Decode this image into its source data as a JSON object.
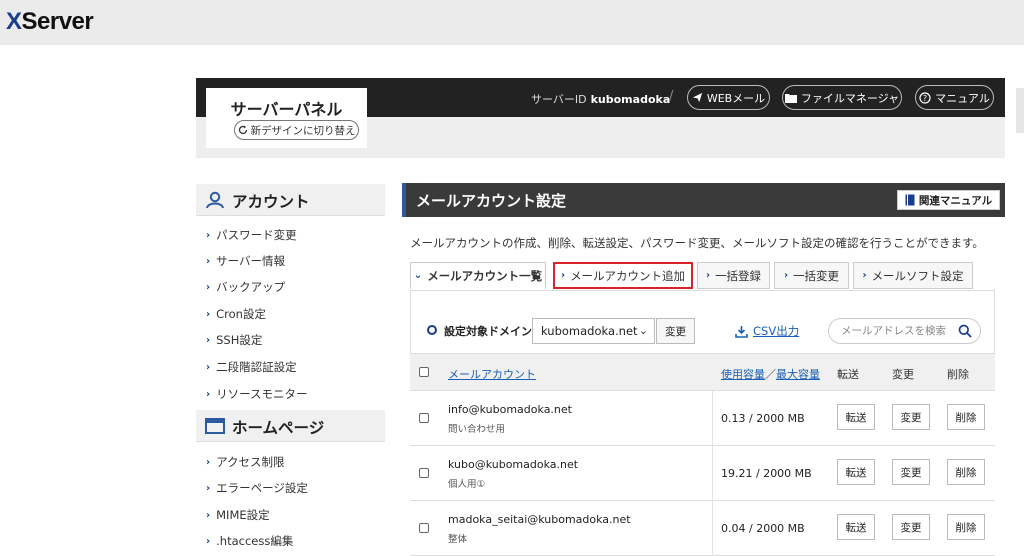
{
  "brand": {
    "logo_x": "X",
    "logo_rest": "Server"
  },
  "header": {
    "panel_title": "サーバーパネル",
    "new_design_label": "新デザインに切り替え",
    "server_id_label": "サーバーID",
    "server_id": "kubomadoka",
    "separator": "/",
    "webmail_label": "WEBメール",
    "file_manager_label": "ファイルマネージャ",
    "manual_label": "マニュアル"
  },
  "sidebar": {
    "sections": [
      {
        "title": "アカウント",
        "icon": "user-icon",
        "items": [
          "パスワード変更",
          "サーバー情報",
          "バックアップ",
          "Cron設定",
          "SSH設定",
          "二段階認証設定",
          "リソースモニター"
        ]
      },
      {
        "title": "ホームページ",
        "icon": "window-icon",
        "items": [
          "アクセス制限",
          "エラーページ設定",
          "MIME設定",
          ".htaccess編集"
        ]
      }
    ]
  },
  "main": {
    "title": "メールアカウント設定",
    "related_manual_label": "関連マニュアル",
    "description": "メールアカウントの作成、削除、転送設定、パスワード変更、メールソフト設定の確認を行うことができます。",
    "tabs": [
      {
        "label": "メールアカウント一覧",
        "active": true
      },
      {
        "label": "メールアカウント追加",
        "highlight": true
      },
      {
        "label": "一括登録"
      },
      {
        "label": "一括変更"
      },
      {
        "label": "メールソフト設定"
      }
    ],
    "filter": {
      "label": "設定対象ドメイン",
      "domain": "kubomadoka.net",
      "change_label": "変更",
      "csv_label": "CSV出力",
      "search_placeholder": "メールアドレスを検索"
    },
    "table": {
      "columns": {
        "account": "メールアカウント",
        "usage": "使用容量",
        "usage_sep": "／",
        "max": "最大容量",
        "forward": "転送",
        "change": "変更",
        "delete": "削除"
      },
      "rows": [
        {
          "email": "info@kubomadoka.net",
          "memo": "問い合わせ用",
          "usage": "0.13 / 2000 MB",
          "forward": "転送",
          "change": "変更",
          "delete": "削除"
        },
        {
          "email": "kubo@kubomadoka.net",
          "memo": "個人用①",
          "usage": "19.21 / 2000 MB",
          "forward": "転送",
          "change": "変更",
          "delete": "削除"
        },
        {
          "email": "madoka_seitai@kubomadoka.net",
          "memo": "整体",
          "usage": "0.04 / 2000 MB",
          "forward": "転送",
          "change": "変更",
          "delete": "削除"
        }
      ]
    }
  },
  "colors": {
    "brand_blue": "#1a3e8c",
    "link_blue": "#1a5fb4",
    "highlight_red": "#d8232a",
    "header_dark": "#222222"
  }
}
